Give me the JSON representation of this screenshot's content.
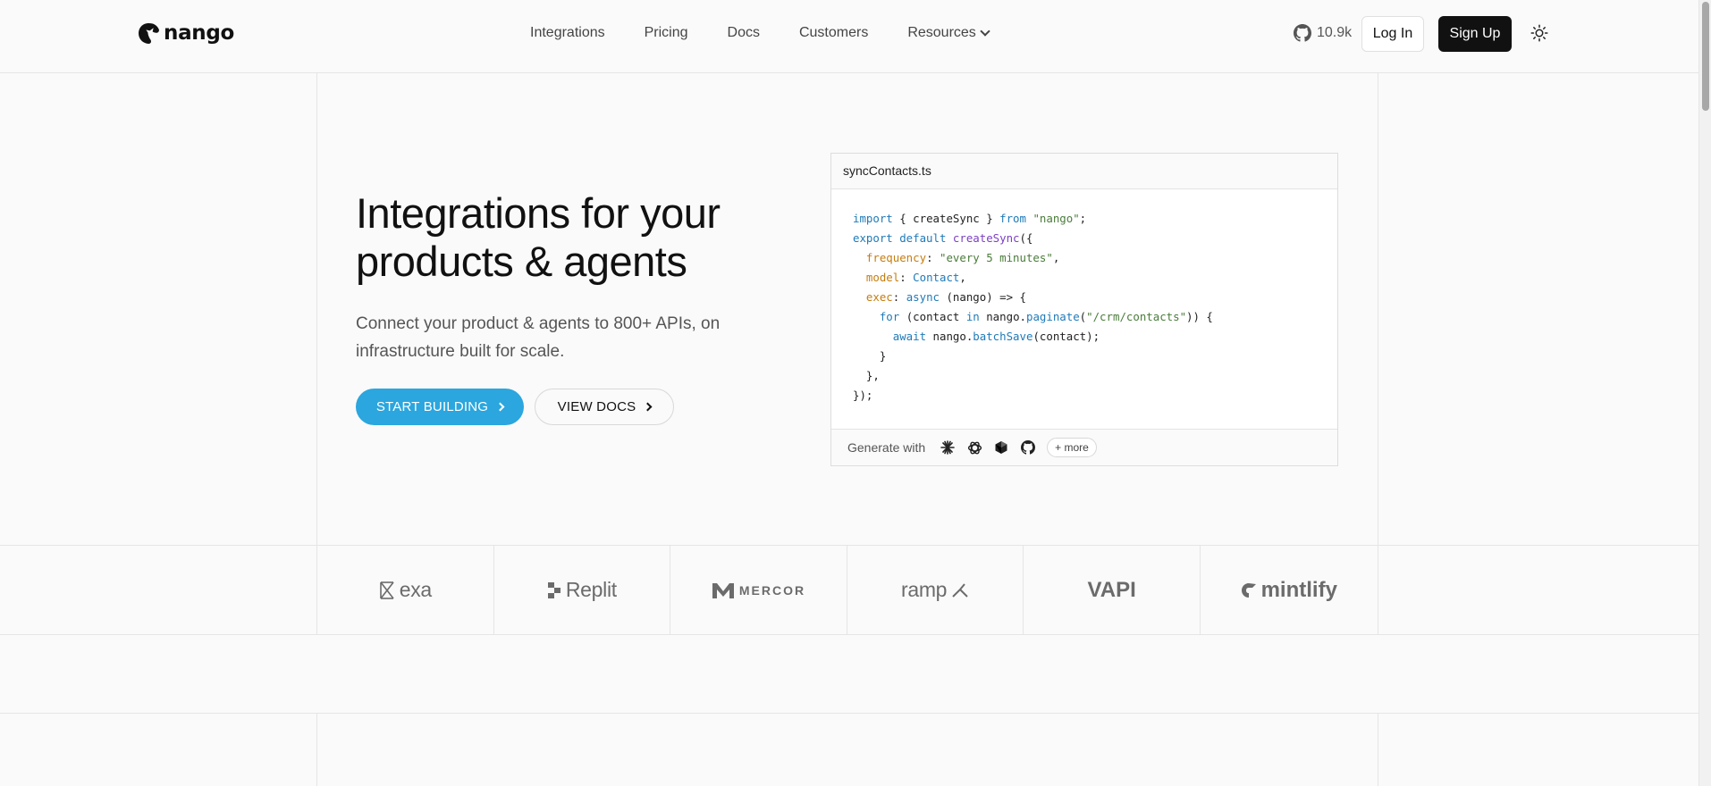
{
  "header": {
    "brand": "nango",
    "nav": [
      {
        "label": "Integrations"
      },
      {
        "label": "Pricing"
      },
      {
        "label": "Docs"
      },
      {
        "label": "Customers"
      },
      {
        "label": "Resources"
      }
    ],
    "github_stars": "10.9k",
    "login_label": "Log In",
    "signup_label": "Sign Up"
  },
  "hero": {
    "title_line1": "Integrations for your",
    "title_line2": "products & agents",
    "subtitle": "Connect your product & agents to 800+ APIs, on infrastructure built for scale.",
    "start_label": "START BUILDING",
    "docs_label": "VIEW DOCS",
    "accent_color": "#2ba6de"
  },
  "code_card": {
    "filename": "syncContacts.ts",
    "generate_label": "Generate with",
    "more_label": "+ more",
    "tools": [
      "claude-icon",
      "openai-icon",
      "cursor-icon",
      "github-icon"
    ]
  },
  "logos": [
    {
      "name": "exa"
    },
    {
      "name": "Replit"
    },
    {
      "name": "MERCOR"
    },
    {
      "name": "ramp"
    },
    {
      "name": "VAPI"
    },
    {
      "name": "mintlify"
    }
  ]
}
